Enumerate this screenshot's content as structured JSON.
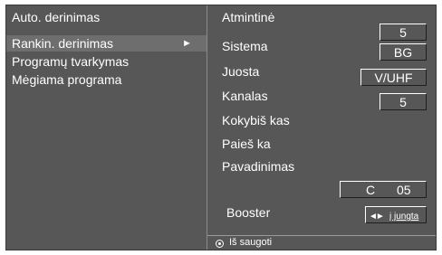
{
  "menu": {
    "items": [
      {
        "label": "Auto. derinimas"
      },
      {
        "label": "Rankin. derinimas",
        "selected": true,
        "arrow": "►"
      },
      {
        "label": "Programų tvarkymas"
      },
      {
        "label": "Mėgiama programa"
      }
    ]
  },
  "settings": {
    "memory_label": "Atmintinė",
    "memory_value": "5",
    "system_label": "Sistema",
    "system_value": "BG",
    "band_label": "Juosta",
    "band_value": "V/UHF",
    "channel_label": "Kanalas",
    "channel_value": "5",
    "quality_label": "Kokybiš kas",
    "search_label": "Paieš ka",
    "name_label": "Pavadinimas",
    "name_value_letter": "C",
    "name_value_number": "05",
    "booster_label": "Booster",
    "booster_arrows": "◄►",
    "booster_value": "į jungta"
  },
  "footer": {
    "save_label": "Iš saugoti",
    "save_icon": "radio-selected-icon"
  },
  "colors": {
    "background": "#575757",
    "text": "#ffffff",
    "selected_row": "#6e6e6e"
  }
}
